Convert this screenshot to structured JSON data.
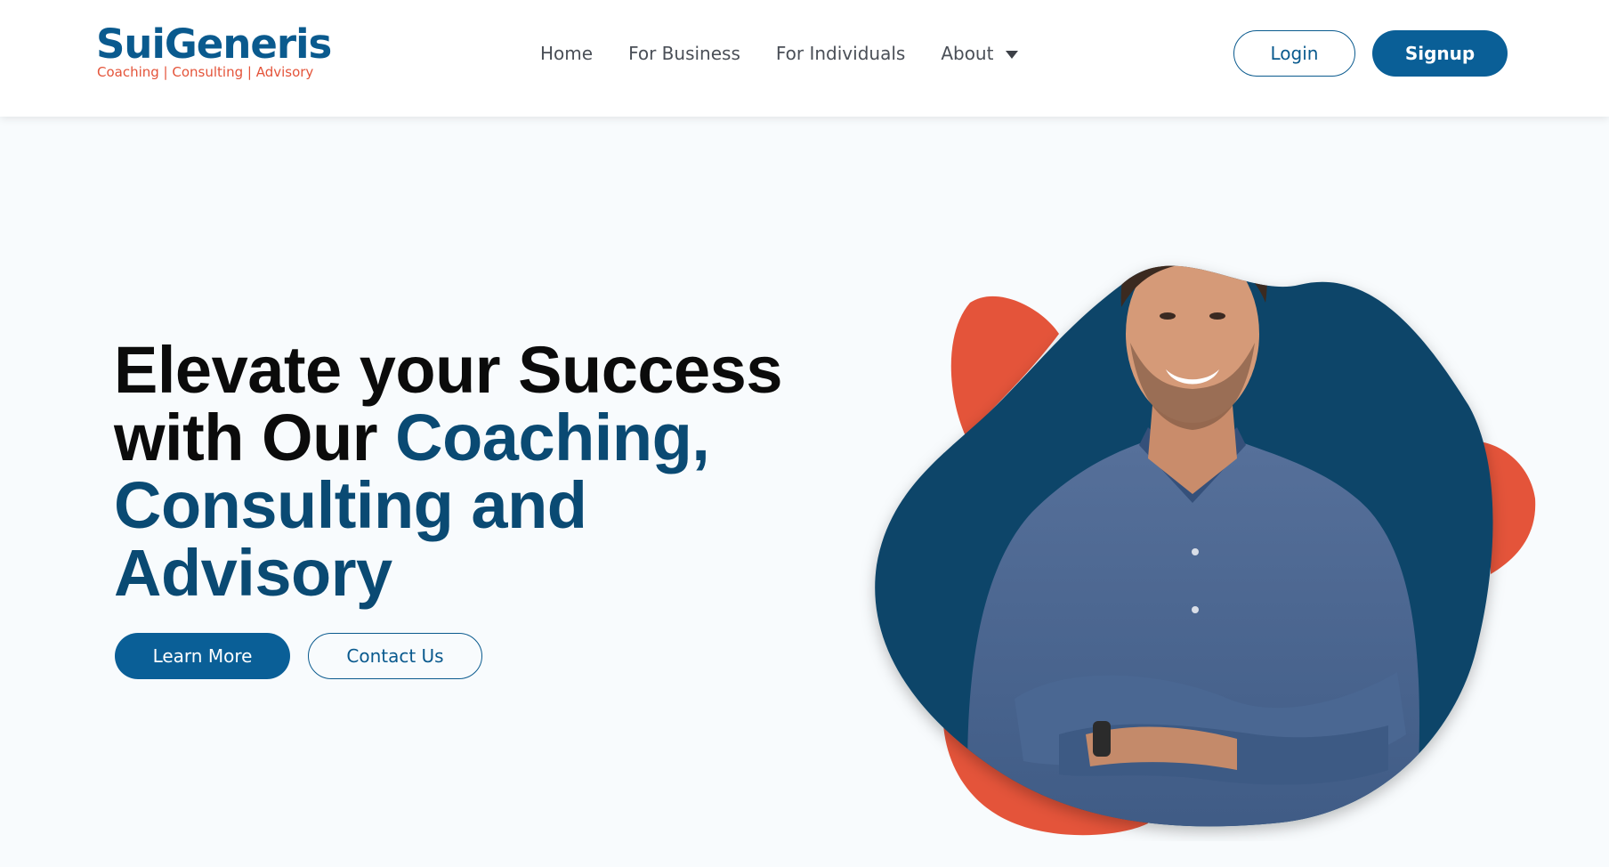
{
  "brand": {
    "name": "SuiGeneris",
    "tagline": "Coaching  |  Consulting  |  Advisory"
  },
  "nav": {
    "items": [
      {
        "label": "Home"
      },
      {
        "label": "For Business"
      },
      {
        "label": "For Individuals"
      },
      {
        "label": "About"
      }
    ]
  },
  "auth": {
    "login_label": "Login",
    "signup_label": "Signup"
  },
  "hero": {
    "title_plain": "Elevate your Success with Our ",
    "title_accent": "Coaching, Consulting and Advisory",
    "learn_more_label": "Learn More",
    "contact_label": "Contact Us"
  },
  "colors": {
    "brand_blue": "#0a5f97",
    "navy": "#0a4a73",
    "accent_orange": "#e4543a",
    "background": "#f8fbfd"
  },
  "icons": {
    "about_dropdown": "caret-down-icon"
  }
}
